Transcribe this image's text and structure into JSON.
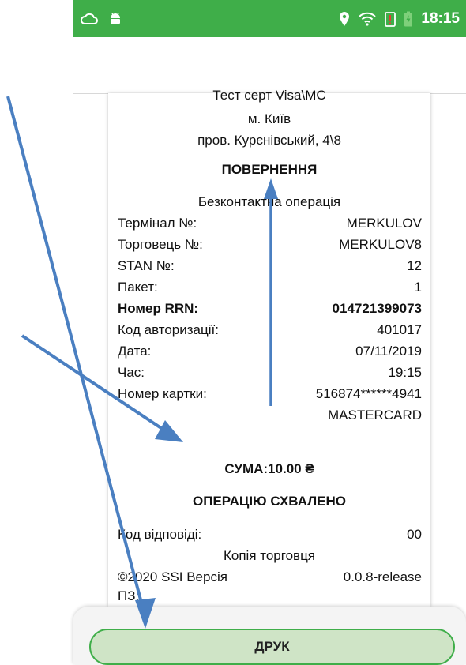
{
  "status_bar": {
    "time": "18:15",
    "icons": [
      "cloud-icon",
      "android-icon",
      "location-icon",
      "wifi-icon",
      "alert-battery-icon",
      "battery-charging-icon"
    ],
    "color": "#3fae49"
  },
  "receipt": {
    "merchant_name": "Тест серт Visa\\MC",
    "city": "м. Київ",
    "address": "пров. Курєнівський, 4\\8",
    "operation_title": "ПОВЕРНЕННЯ",
    "operation_type": "Безконтактна операція",
    "rows": [
      {
        "label": "Термінал №:",
        "value": "MERKULOV"
      },
      {
        "label": "Торговець №:",
        "value": "MERKULOV8"
      },
      {
        "label": "STAN №:",
        "value": "12"
      },
      {
        "label": "Пакет:",
        "value": "1"
      },
      {
        "label": "Номер RRN:",
        "value": "014721399073"
      },
      {
        "label": "Код авторизації:",
        "value": "401017"
      },
      {
        "label": "Дата:",
        "value": "07/11/2019"
      },
      {
        "label": "Час:",
        "value": "19:15"
      },
      {
        "label": "Номер картки:",
        "value": "516874******4941"
      }
    ],
    "card_scheme": "MASTERCARD",
    "amount": "СУМА:10.00 ₴",
    "approval": "ОПЕРАЦІЮ СХВАЛЕНО",
    "response_code_label": "Код відповіді:",
    "response_code_value": "00",
    "copy_label": "Копія торговця",
    "version_label": "©2020 SSI Версія",
    "version_value": "0.0.8-release",
    "software_label": "ПЗ:"
  },
  "actions": {
    "print_label": "ДРУК"
  },
  "colors": {
    "accent": "#3fae49",
    "button_fill": "#cfe4c6",
    "annotation_arrow": "#4a7fc1"
  }
}
